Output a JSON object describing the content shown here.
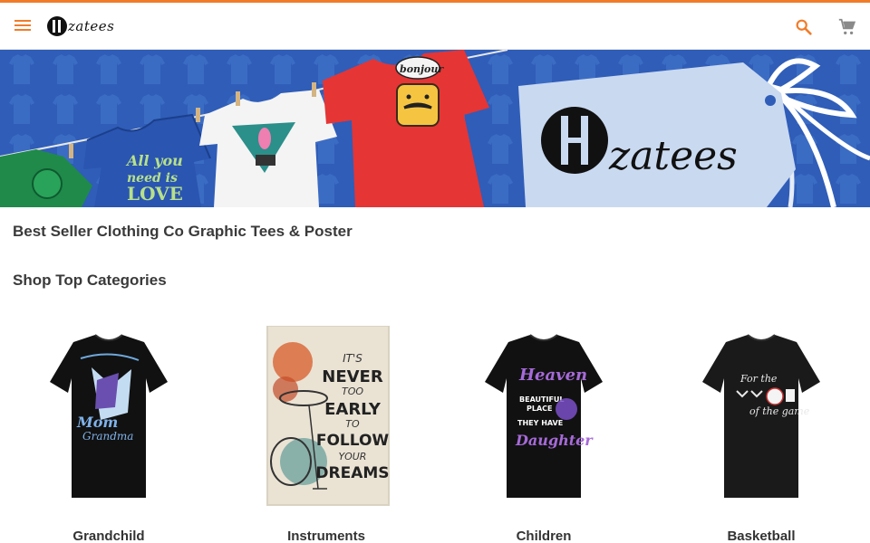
{
  "header": {
    "logo_text": "zatees",
    "menu_icon": "menu-icon",
    "search_icon": "search-icon",
    "cart_icon": "cart-icon"
  },
  "banner": {
    "brand_text": "zatees",
    "shirt_texts": [
      "All you need is LOVE",
      "bonjour"
    ]
  },
  "main": {
    "tagline": "Best Seller Clothing Co Graphic Tees & Poster",
    "section_title": "Shop Top Categories"
  },
  "categories": [
    {
      "label": "Grandchild"
    },
    {
      "label": "Instruments",
      "poster_lines": [
        "IT'S",
        "NEVER",
        "TOO",
        "EARLY",
        "TO",
        "FOLLOW",
        "YOUR",
        "DREAMS"
      ]
    },
    {
      "label": "Children"
    },
    {
      "label": "Basketball",
      "shirt_text": "of the game"
    }
  ],
  "colors": {
    "accent": "#f07c2a",
    "banner_blue": "#2f5db8",
    "tag_light_blue": "#c9d9f0"
  }
}
